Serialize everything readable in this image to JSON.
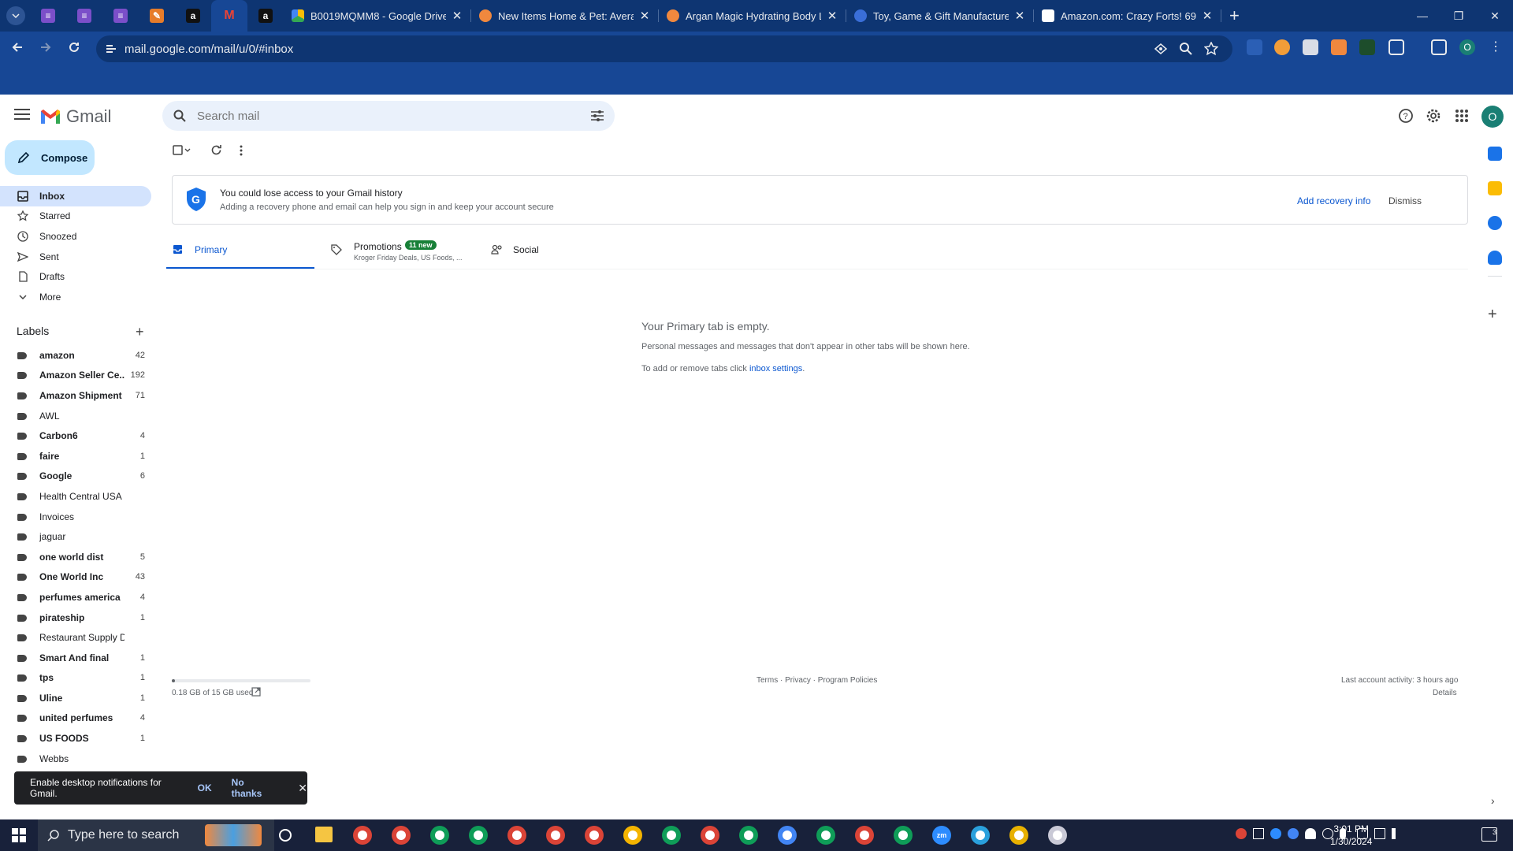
{
  "browser": {
    "tabs": [
      {
        "title": "B0019MQMM8 - Google Drive",
        "favicon": "google-drive"
      },
      {
        "title": "New Items Home & Pet: Averag",
        "favicon": "orange-circle"
      },
      {
        "title": "Argan Magic Hydrating Body Lo",
        "favicon": "orange-circle"
      },
      {
        "title": "Toy, Game & Gift Manufacturer",
        "favicon": "globe-blue"
      },
      {
        "title": "Amazon.com: Crazy Forts! 69 Pi",
        "favicon": "amazon"
      }
    ],
    "url": "mail.google.com/mail/u/0/#inbox",
    "profile_initial": "O",
    "new_tab_label": "+"
  },
  "gmail": {
    "app_name": "Gmail",
    "search_placeholder": "Search mail",
    "compose_label": "Compose",
    "nav": [
      {
        "label": "Inbox",
        "icon": "inbox-icon",
        "active": true
      },
      {
        "label": "Starred",
        "icon": "star-icon"
      },
      {
        "label": "Snoozed",
        "icon": "clock-icon"
      },
      {
        "label": "Sent",
        "icon": "send-icon"
      },
      {
        "label": "Drafts",
        "icon": "draft-icon"
      },
      {
        "label": "More",
        "icon": "chevron-down-icon"
      }
    ],
    "labels_title": "Labels",
    "labels": [
      {
        "name": "amazon",
        "count": "42",
        "bold": true
      },
      {
        "name": "Amazon Seller Ce...",
        "count": "192",
        "bold": true
      },
      {
        "name": "Amazon Shipment",
        "count": "71",
        "bold": true
      },
      {
        "name": "AWL",
        "count": "",
        "bold": false
      },
      {
        "name": "Carbon6",
        "count": "4",
        "bold": true
      },
      {
        "name": "faire",
        "count": "1",
        "bold": true
      },
      {
        "name": "Google",
        "count": "6",
        "bold": true
      },
      {
        "name": "Health Central USA",
        "count": "",
        "bold": false
      },
      {
        "name": "Invoices",
        "count": "",
        "bold": false
      },
      {
        "name": "jaguar",
        "count": "",
        "bold": false
      },
      {
        "name": "one world dist",
        "count": "5",
        "bold": true
      },
      {
        "name": "One World Inc",
        "count": "43",
        "bold": true
      },
      {
        "name": "perfumes america",
        "count": "4",
        "bold": true
      },
      {
        "name": "pirateship",
        "count": "1",
        "bold": true
      },
      {
        "name": "Restaurant Supply D",
        "count": "",
        "bold": false
      },
      {
        "name": "Smart And final",
        "count": "1",
        "bold": true
      },
      {
        "name": "tps",
        "count": "1",
        "bold": true
      },
      {
        "name": "Uline",
        "count": "1",
        "bold": true
      },
      {
        "name": "united perfumes",
        "count": "4",
        "bold": true
      },
      {
        "name": "US FOODS",
        "count": "1",
        "bold": true
      },
      {
        "name": "Webbs",
        "count": "",
        "bold": false
      }
    ],
    "banner": {
      "title": "You could lose access to your Gmail history",
      "subtitle": "Adding a recovery phone and email can help you sign in and keep your account secure",
      "action": "Add recovery info",
      "dismiss": "Dismiss"
    },
    "tabs": {
      "primary": "Primary",
      "promotions": "Promotions",
      "promotions_badge": "11 new",
      "promotions_snippet": "Kroger Friday Deals, US Foods, ...",
      "social": "Social"
    },
    "empty": {
      "title": "Your Primary tab is empty.",
      "line1": "Personal messages and messages that don't appear in other tabs will be shown here.",
      "line2_prefix": "To add or remove tabs click",
      "line2_link": "inbox settings",
      "line2_suffix": "."
    },
    "footer": {
      "storage": "0.18 GB of 15 GB used",
      "storage_fraction": 0.012,
      "links": "Terms · Privacy · Program Policies",
      "activity": "Last account activity: 3 hours ago",
      "details": "Details"
    },
    "snackbar": {
      "message": "Enable desktop notifications for Gmail.",
      "ok": "OK",
      "no_thanks": "No thanks"
    }
  },
  "taskbar": {
    "search_placeholder": "Type here to search",
    "time": "3:01 PM",
    "date": "1/30/2024",
    "notification_count": "3"
  },
  "colors": {
    "chrome_dark": "#0e3572",
    "chrome_blue": "#174795",
    "accent": "#0b57d0",
    "compose_bg": "#c2e7ff",
    "active_nav": "#d3e3fd",
    "promo_badge": "#188038"
  }
}
